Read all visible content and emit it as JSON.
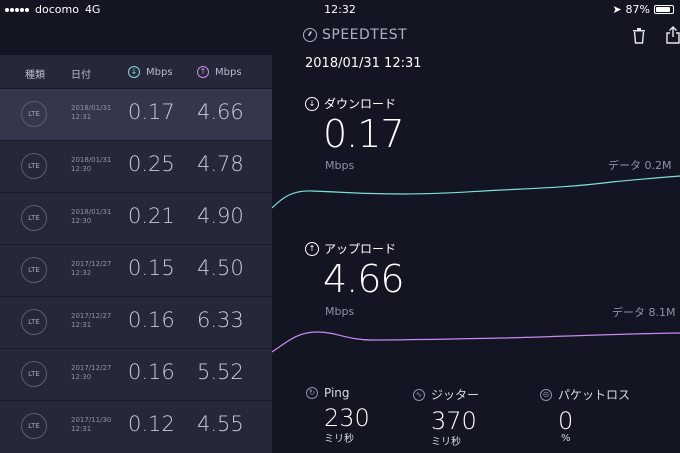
{
  "status": {
    "carrier": "docomo",
    "network": "4G",
    "time": "12:32",
    "battery": "87%"
  },
  "app": {
    "brand": "SPEEDTEST"
  },
  "history": {
    "headers": {
      "type": "種類",
      "date": "日付",
      "download": "Mbps",
      "upload": "Mbps"
    },
    "rows": [
      {
        "type": "LTE",
        "date": "2018/01/31",
        "time": "12:31",
        "download": "0.17",
        "upload": "4.66",
        "active": true
      },
      {
        "type": "LTE",
        "date": "2018/01/31",
        "time": "12:30",
        "download": "0.25",
        "upload": "4.78"
      },
      {
        "type": "LTE",
        "date": "2018/01/31",
        "time": "12:30",
        "download": "0.21",
        "upload": "4.90"
      },
      {
        "type": "LTE",
        "date": "2017/12/27",
        "time": "12:32",
        "download": "0.15",
        "upload": "4.50"
      },
      {
        "type": "LTE",
        "date": "2017/12/27",
        "time": "12:31",
        "download": "0.16",
        "upload": "6.33"
      },
      {
        "type": "LTE",
        "date": "2017/12/27",
        "time": "12:30",
        "download": "0.16",
        "upload": "5.52"
      },
      {
        "type": "LTE",
        "date": "2017/11/30",
        "time": "12:31",
        "download": "0.12",
        "upload": "4.55"
      }
    ]
  },
  "result": {
    "datetime": "2018/01/31 12:31",
    "download": {
      "label": "ダウンロード",
      "value": "0.17",
      "unit": "Mbps",
      "data": "データ 0.2M",
      "color": "#7ee0d4"
    },
    "upload": {
      "label": "アップロード",
      "value": "4.66",
      "unit": "Mbps",
      "data": "データ 8.1M",
      "color": "#c88bf0"
    },
    "ping": {
      "label": "Ping",
      "value": "230",
      "unit": "ミリ秒"
    },
    "jitter": {
      "label": "ジッター",
      "value": "370",
      "unit": "ミリ秒"
    },
    "loss": {
      "label": "パケットロス",
      "value": "0",
      "unit": "%"
    }
  }
}
